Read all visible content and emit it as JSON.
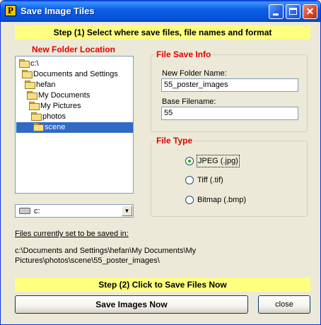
{
  "window": {
    "title": "Save Image Tiles",
    "icon": "P"
  },
  "step1": "Step (1) Select where save files, file names and format",
  "folder_panel": {
    "heading": "New Folder  Location",
    "tree": [
      {
        "label": "c:\\",
        "state": "open"
      },
      {
        "label": "Documents and Settings",
        "state": "open"
      },
      {
        "label": "hefan",
        "state": "open"
      },
      {
        "label": "My Documents",
        "state": "open"
      },
      {
        "label": "My Pictures",
        "state": "open"
      },
      {
        "label": "photos",
        "state": "open"
      },
      {
        "label": "scene",
        "state": "selected"
      }
    ],
    "drive": "c:"
  },
  "file_save_info": {
    "title": "File Save Info",
    "folder_name_label": "New Folder Name:",
    "folder_name_value": "55_poster_images",
    "base_filename_label": "Base Filename:",
    "base_filename_value": "55"
  },
  "file_type": {
    "title": "File Type",
    "options": [
      {
        "label": "JPEG (.jpg)",
        "checked": true
      },
      {
        "label": "Tiff (.tif)",
        "checked": false
      },
      {
        "label": "Bitmap (.bmp)",
        "checked": false
      }
    ]
  },
  "save_path": {
    "label": "Files currently set to be saved in:",
    "path": "c:\\Documents and Settings\\hefan\\My Documents\\My Pictures\\photos\\scene\\55_poster_images\\"
  },
  "step2": "Step (2) Click to Save Files Now",
  "buttons": {
    "save": "Save Images Now",
    "close": "close"
  },
  "colors": {
    "step_bar": "#ffff80",
    "heading_red": "#e00000",
    "selection": "#316ac5",
    "titlebar": "#0c5fe6"
  }
}
